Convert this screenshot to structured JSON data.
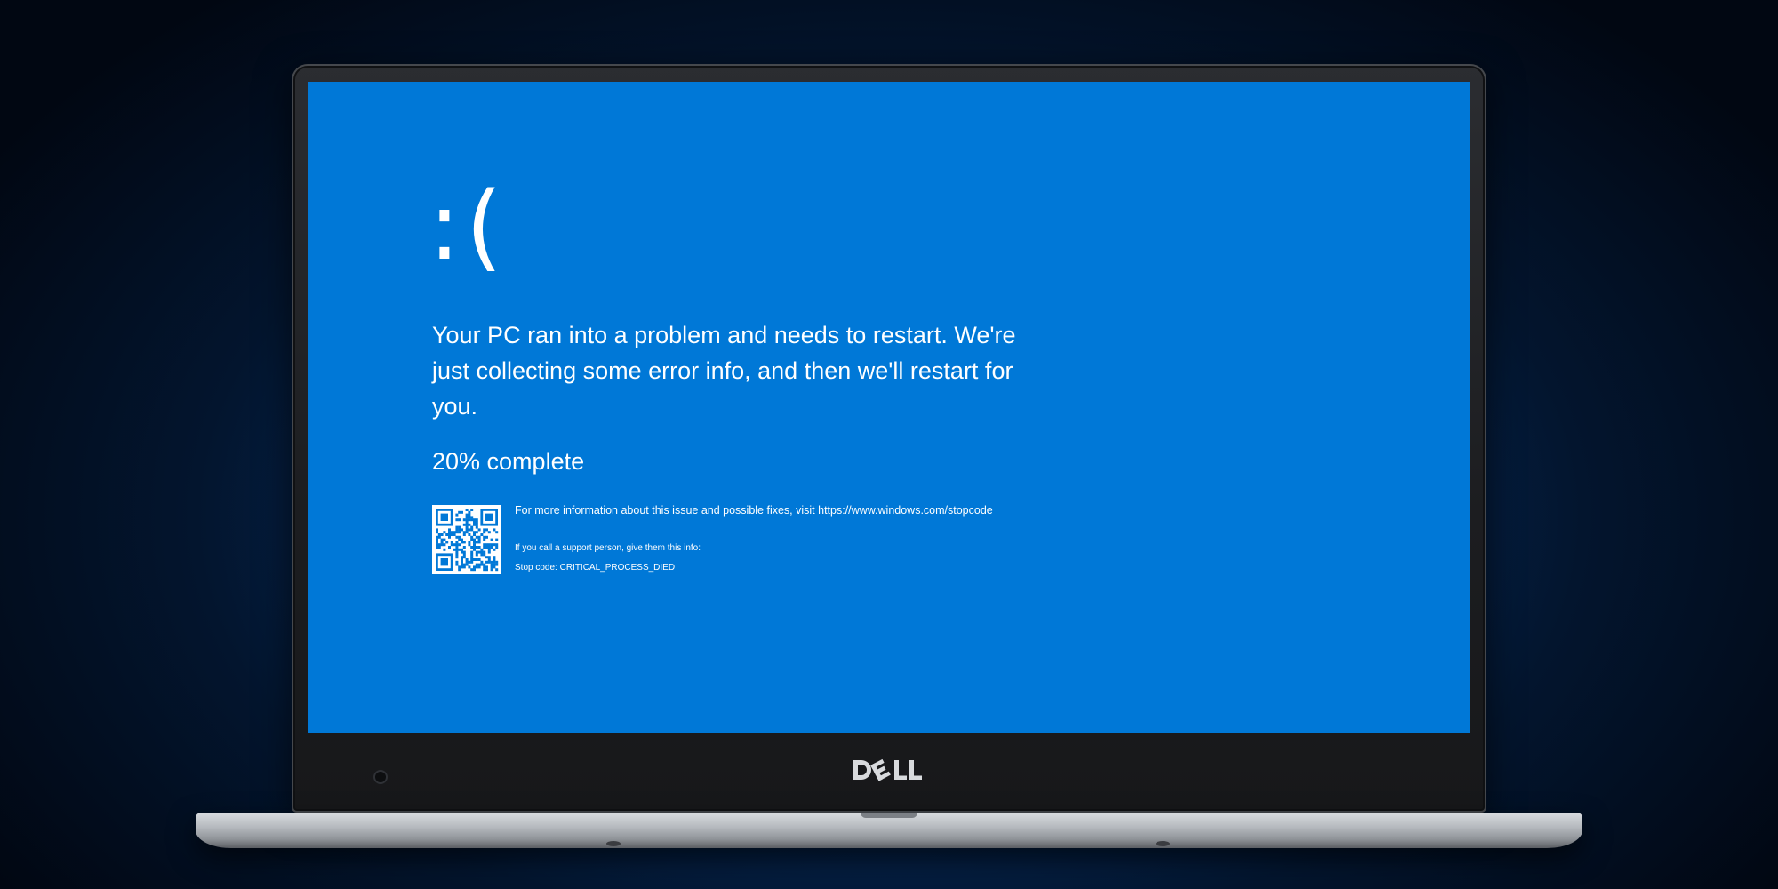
{
  "bsod": {
    "face": ":(",
    "message": "Your PC ran into a problem and needs to restart. We're just collecting some error info, and then we'll restart for you.",
    "progress_text": "20% complete",
    "progress_percent": 20,
    "info_line": "For more information about this issue and possible fixes, visit https://www.windows.com/stopcode",
    "support_line": "If you call a support person, give them this info:",
    "stop_code": "Stop code: CRITICAL_PROCESS_DIED",
    "background_color": "#0078d7",
    "text_color": "#ffffff"
  },
  "laptop": {
    "brand": "DELL",
    "logo_icon": "dell-logo"
  },
  "icons": {
    "qr": "qr-code-icon",
    "camera": "webcam-icon"
  }
}
